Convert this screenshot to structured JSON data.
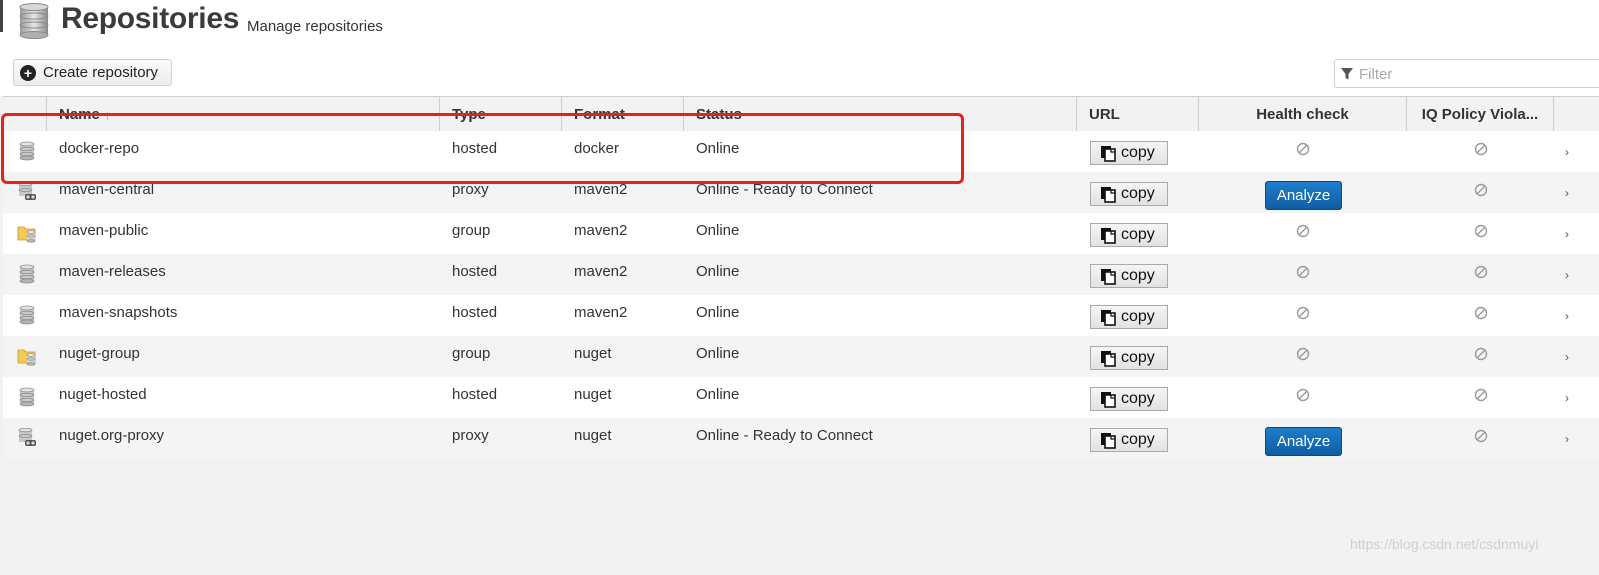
{
  "header": {
    "title": "Repositories",
    "subtitle": "Manage repositories",
    "icon": "database-icon"
  },
  "toolbar": {
    "create_label": "Create repository",
    "filter_placeholder": "Filter"
  },
  "table": {
    "columns": [
      {
        "key": "name",
        "label": "Name",
        "sorted": "ascending"
      },
      {
        "key": "type",
        "label": "Type"
      },
      {
        "key": "format",
        "label": "Format"
      },
      {
        "key": "status",
        "label": "Status"
      },
      {
        "key": "url",
        "label": "URL"
      },
      {
        "key": "health",
        "label": "Health check"
      },
      {
        "key": "iq",
        "label": "IQ Policy Viola..."
      }
    ],
    "copy_label": "copy",
    "analyze_label": "Analyze",
    "rows": [
      {
        "icon": "hosted-repo-icon",
        "name": "docker-repo",
        "type": "hosted",
        "format": "docker",
        "status": "Online",
        "health": "none"
      },
      {
        "icon": "proxy-repo-icon",
        "name": "maven-central",
        "type": "proxy",
        "format": "maven2",
        "status": "Online - Ready to Connect",
        "health": "analyze"
      },
      {
        "icon": "group-repo-icon",
        "name": "maven-public",
        "type": "group",
        "format": "maven2",
        "status": "Online",
        "health": "none"
      },
      {
        "icon": "hosted-repo-icon",
        "name": "maven-releases",
        "type": "hosted",
        "format": "maven2",
        "status": "Online",
        "health": "none"
      },
      {
        "icon": "hosted-repo-icon",
        "name": "maven-snapshots",
        "type": "hosted",
        "format": "maven2",
        "status": "Online",
        "health": "none"
      },
      {
        "icon": "group-repo-icon",
        "name": "nuget-group",
        "type": "group",
        "format": "nuget",
        "status": "Online",
        "health": "none"
      },
      {
        "icon": "hosted-repo-icon",
        "name": "nuget-hosted",
        "type": "hosted",
        "format": "nuget",
        "status": "Online",
        "health": "none"
      },
      {
        "icon": "proxy-repo-icon",
        "name": "nuget.org-proxy",
        "type": "proxy",
        "format": "nuget",
        "status": "Online - Ready to Connect",
        "health": "analyze"
      }
    ]
  },
  "annotation": {
    "highlight_color": "#e8211b"
  },
  "watermark": "https://blog.csdn.net/csdnmuyi",
  "colors": {
    "accent": "#1468b8",
    "row_alt": "#f4f4f4"
  }
}
